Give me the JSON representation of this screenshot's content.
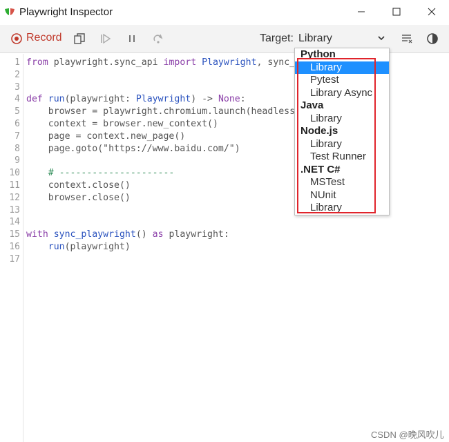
{
  "window": {
    "title": "Playwright Inspector"
  },
  "toolbar": {
    "record_label": "Record",
    "target_label": "Target:",
    "target_value": "Library"
  },
  "colors": {
    "record": "#c0392b",
    "selected": "#1e90ff",
    "highlight": "#e0242b"
  },
  "code": {
    "line_numbers": [
      "1",
      "2",
      "3",
      "4",
      "5",
      "6",
      "7",
      "8",
      "9",
      "10",
      "11",
      "12",
      "13",
      "14",
      "15",
      "16",
      "17"
    ],
    "lines": [
      {
        "t": "from playwright.sync_api import Playwright, sync_p"
      },
      {
        "t": ""
      },
      {
        "t": ""
      },
      {
        "t": "def run(playwright: Playwright) -> None:"
      },
      {
        "t": "    browser = playwright.chromium.launch(headless="
      },
      {
        "t": "    context = browser.new_context()"
      },
      {
        "t": "    page = context.new_page()"
      },
      {
        "t": "    page.goto(\"https://www.baidu.com/\")"
      },
      {
        "t": ""
      },
      {
        "t": "    # ---------------------"
      },
      {
        "t": "    context.close()"
      },
      {
        "t": "    browser.close()"
      },
      {
        "t": ""
      },
      {
        "t": ""
      },
      {
        "t": "with sync_playwright() as playwright:"
      },
      {
        "t": "    run(playwright)"
      },
      {
        "t": ""
      }
    ]
  },
  "dropdown": {
    "groups": [
      {
        "label": "Python",
        "options": [
          "Library",
          "Pytest",
          "Library Async"
        ]
      },
      {
        "label": "Java",
        "options": [
          "Library"
        ]
      },
      {
        "label": "Node.js",
        "options": [
          "Library",
          "Test Runner"
        ]
      },
      {
        "label": ".NET C#",
        "options": [
          "MSTest",
          "NUnit",
          "Library"
        ]
      }
    ],
    "selected": "Python / Library"
  },
  "watermark": "CSDN @晚风吹儿"
}
